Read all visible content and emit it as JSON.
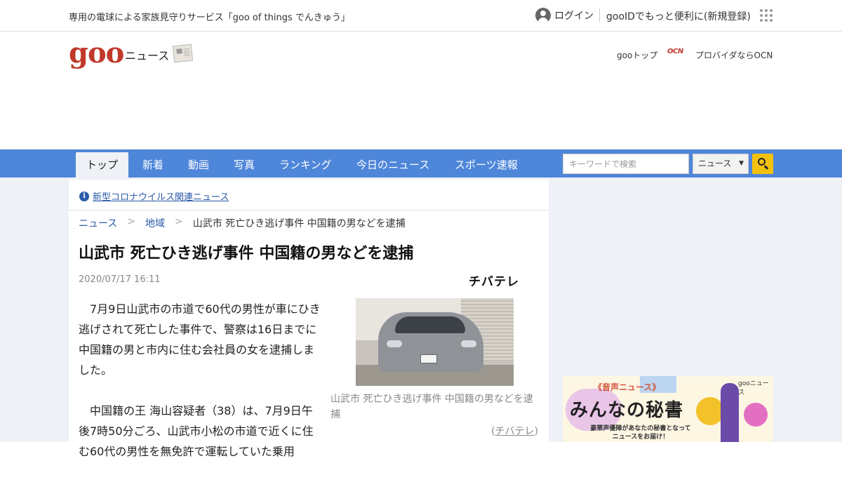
{
  "topbar": {
    "promo": "専用の電球による家族見守りサービス「goo of things でんきゅう」",
    "login": "ログイン",
    "register": "gooIDでもっと便利に(新規登録)"
  },
  "header": {
    "logo": "goo",
    "section": "ニュース",
    "goo_top": "gooトップ",
    "ocn_logo": "OCN",
    "ocn_text": "プロバイダならOCN"
  },
  "nav": {
    "tabs": [
      {
        "label": "トップ",
        "active": true
      },
      {
        "label": "新着"
      },
      {
        "label": "動画"
      },
      {
        "label": "写真"
      },
      {
        "label": "ランキング"
      },
      {
        "label": "今日のニュース"
      },
      {
        "label": "スポーツ速報"
      }
    ],
    "search_placeholder": "キーワードで検索",
    "search_scope": "ニュース"
  },
  "notice": {
    "text": "新型コロナウイルス関連ニュース"
  },
  "breadcrumb": {
    "items": [
      "ニュース",
      "地域",
      "山武市 死亡ひき逃げ事件 中国籍の男などを逮捕"
    ],
    "separator": ">"
  },
  "article": {
    "title": "山武市 死亡ひき逃げ事件 中国籍の男などを逮捕",
    "date": "2020/07/17 16:11",
    "source_logo": "チバテレ",
    "paragraphs": [
      "7月9日山武市の市道で60代の男性が車にひき逃げされて死亡した事件で、警察は16日までに中国籍の男と市内に住む会社員の女を逮捕しました。",
      "中国籍の王 海山容疑者（38）は、7月9日午後7時50分ごろ、山武市小松の市道で近くに住む60代の男性を無免許で運転していた乗用"
    ],
    "caption": "山武市 死亡ひき逃げ事件 中国籍の男などを逮捕",
    "credit": "チバテレ"
  },
  "ad": {
    "tag": "《音声ニュース》",
    "headline": "みんなの秘書",
    "sub": "豪華声優陣があなたの秘書となって ニュースをお届け！",
    "brand": "gooニュース"
  }
}
